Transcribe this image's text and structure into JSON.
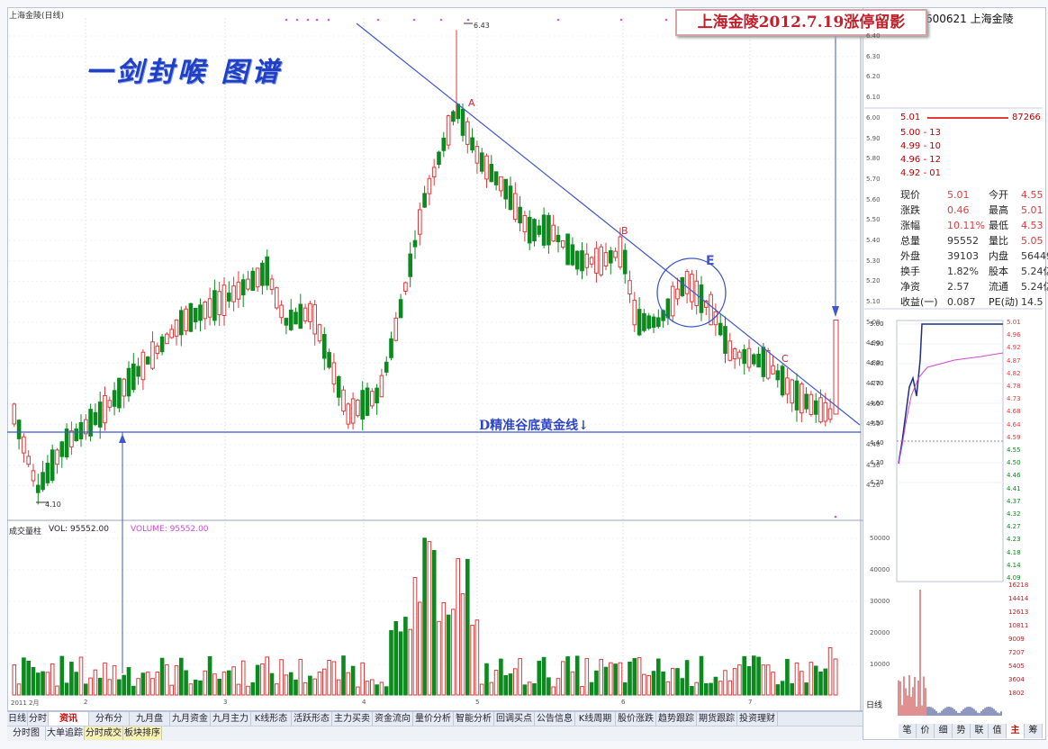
{
  "window": {
    "kline_title": "上海金陵(日线)",
    "stock_code_name": "600621 上海金陵"
  },
  "overlay": {
    "brand_title": "一剑封喉 图谱",
    "caption": "上海金陵2012.7.19涨停留影",
    "label_A": "A",
    "label_B": "B",
    "label_C": "C",
    "label_E": "E",
    "support_line_label": "D精准谷底黄金线↓",
    "high_price_label": "6.43",
    "low_price_label": "4.10"
  },
  "kline": {
    "y_axis": [
      "6.40",
      "6.30",
      "6.20",
      "6.10",
      "6.00",
      "5.90",
      "5.80",
      "5.70",
      "5.60",
      "5.50",
      "5.40",
      "5.30",
      "5.20",
      "5.10",
      "5.00",
      "4.90",
      "4.80",
      "4.70",
      "4.60",
      "4.50",
      "4.40",
      "4.30",
      "4.20"
    ],
    "x_axis": [
      "2011 2月",
      "2",
      "3",
      "4",
      "5",
      "6",
      "7"
    ]
  },
  "volume": {
    "header_name": "成交量柱",
    "header_vol": "VOL: 95552.00",
    "header_volume": "VOLUME: 95552.00",
    "y_axis": [
      "50000",
      "40000",
      "30000",
      "20000",
      "10000"
    ],
    "x_unit": "日线"
  },
  "bottom_tabs": [
    "日线",
    "分时",
    "资讯",
    "分布分",
    "九月盘",
    "九月资金",
    "九月主力",
    "K线形态",
    "活跃形态",
    "主力买卖",
    "资金流向",
    "量价分析",
    "智能分析",
    "回调买点",
    "公告信息",
    "K线周期",
    "股价涨跌",
    "趋势跟踪",
    "期货跟踪",
    "投资理财"
  ],
  "bottom_tabs2": [
    "分时图",
    "大单追踪",
    "分时成交",
    "板块排序"
  ],
  "orderbook": {
    "ask": [
      {
        "price": "5.01",
        "vol": "87266"
      }
    ],
    "bid": [
      {
        "price": "5.00",
        "vol": "13"
      },
      {
        "price": "4.99",
        "vol": "10"
      },
      {
        "price": "4.96",
        "vol": "12"
      },
      {
        "price": "4.92",
        "vol": "01"
      }
    ]
  },
  "quote": [
    {
      "l1": "现价",
      "v1": "5.01",
      "l2": "今开",
      "v2": "4.55"
    },
    {
      "l1": "涨跌",
      "v1": "0.46",
      "l2": "最高",
      "v2": "5.01"
    },
    {
      "l1": "涨幅",
      "v1": "10.11%",
      "l2": "最低",
      "v2": "4.53"
    },
    {
      "l1": "总量",
      "v1": "95552",
      "l2": "量比",
      "v2": "5.05"
    },
    {
      "l1": "外盘",
      "v1": "39103",
      "l2": "内盘",
      "v2": "56449"
    },
    {
      "l1": "换手",
      "v1": "1.82%",
      "l2": "股本",
      "v2": "5.24亿"
    },
    {
      "l1": "净资",
      "v1": "2.57",
      "l2": "流通",
      "v2": "5.24亿"
    },
    {
      "l1": "收益(一)",
      "v1": "0.087",
      "l2": "PE(动)",
      "v2": "14.5"
    }
  ],
  "intraday": {
    "left_axis": [
      "5.00",
      "4.90",
      "4.80",
      "4.70",
      "4.60",
      "4.50",
      "4.40",
      "4.30",
      "4.20"
    ],
    "right_axis": [
      "5.01",
      "4.96",
      "4.92",
      "4.87",
      "4.82",
      "4.78",
      "4.73",
      "4.68",
      "4.64",
      "4.59",
      "4.55",
      "4.50",
      "4.46",
      "4.41",
      "4.37",
      "4.32",
      "4.27",
      "4.23",
      "4.18",
      "4.14",
      "4.09"
    ],
    "vol_axis": [
      "16218",
      "14414",
      "12613",
      "10811",
      "9009",
      "7207",
      "5405",
      "3604",
      "1802"
    ]
  },
  "right_tabs": [
    "笔",
    "价",
    "细",
    "势",
    "联",
    "值",
    "主",
    "筹"
  ],
  "colors": {
    "up": "#e03a3a",
    "down": "#0b8a1e",
    "trend": "#3f57c9",
    "caption": "#c0202c"
  }
}
